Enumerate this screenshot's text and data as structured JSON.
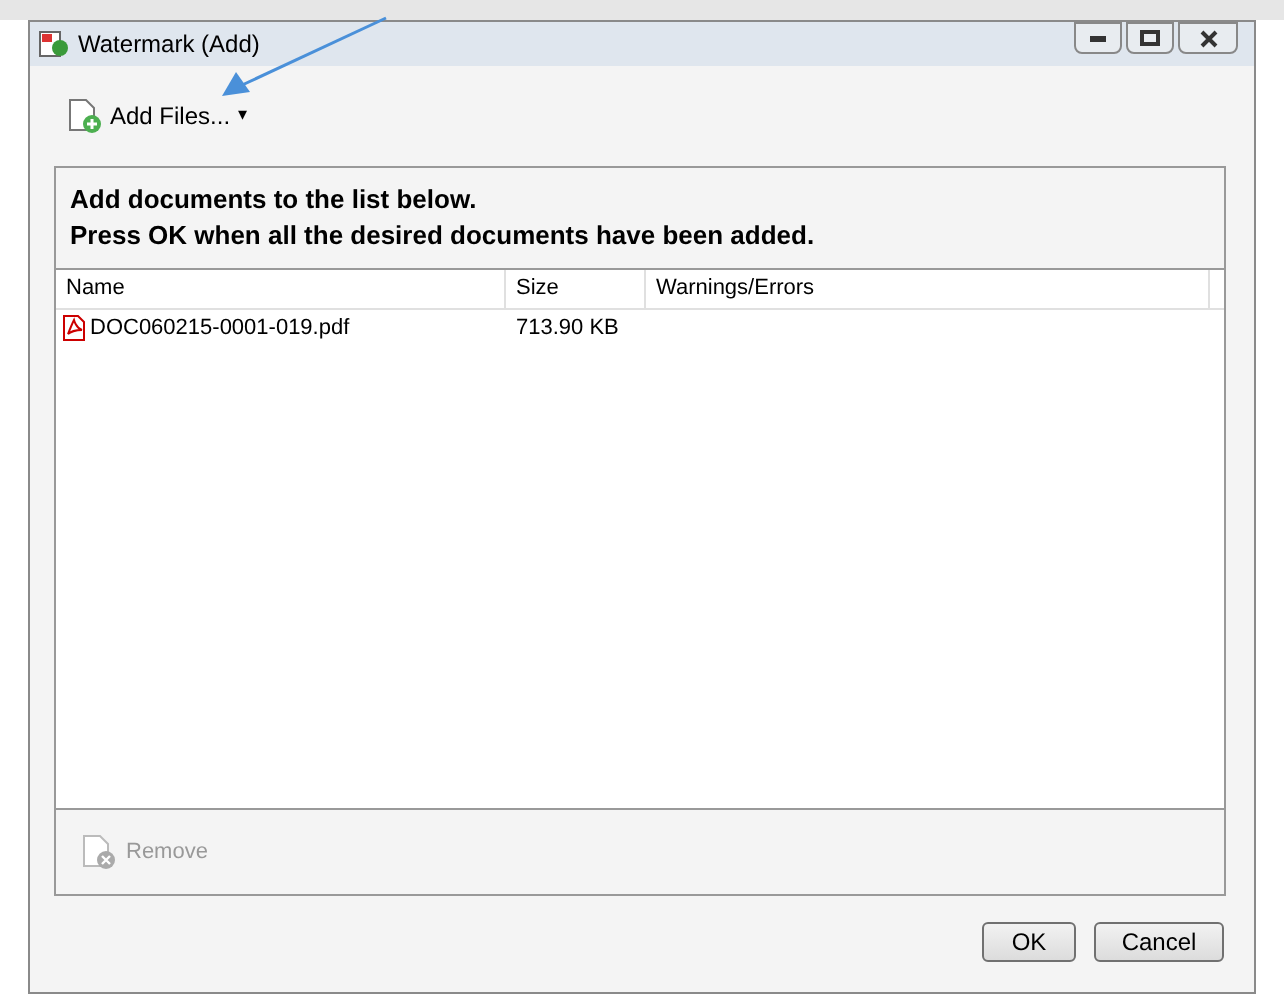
{
  "window": {
    "title": "Watermark (Add)"
  },
  "toolbar": {
    "add_button": {
      "label": "Add Files...",
      "caret": "▾"
    }
  },
  "instructions": [
    "Add documents to the list below.",
    "Press OK when all the desired documents have been added."
  ],
  "table": {
    "columns": [
      "Name",
      "Size",
      "Warnings/Errors"
    ],
    "rows": [
      {
        "name": "DOC060215-0001-019.pdf",
        "size": "713.90 KB",
        "selected": false
      }
    ]
  },
  "remove_button": {
    "label": "Remove",
    "disabled": true
  },
  "buttons": [
    {
      "label": "OK"
    },
    {
      "label": "Cancel"
    }
  ]
}
